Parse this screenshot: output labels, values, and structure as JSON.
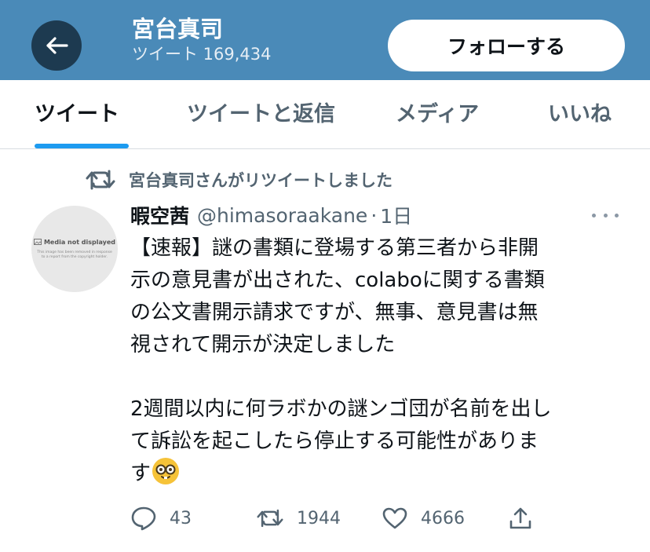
{
  "header": {
    "name": "宮台真司",
    "subtitle": "ツイート 169,434",
    "follow_label": "フォローする",
    "bg_color": "#4a8ab8"
  },
  "tabs": [
    {
      "label": "ツイート",
      "active": true
    },
    {
      "label": "ツイートと返信",
      "active": false
    },
    {
      "label": "メディア",
      "active": false
    },
    {
      "label": "いいね",
      "active": false
    }
  ],
  "retweet": {
    "text": "宮台真司さんがリツイートしました",
    "icon": "retweet-icon"
  },
  "avatar": {
    "title": "Media not displayed",
    "body": "This image has been removed in response to a report from the copyright holder."
  },
  "tweet": {
    "author_name": "暇空茜",
    "handle": "@himasoraakane",
    "dot": "·",
    "time": "1日",
    "lines": [
      "【速報】謎の書類に登場する第三者から非開",
      "示の意見書が出された、colaboに関する書類",
      "の公文書開示請求ですが、無事、意見書は無",
      "視されて開示が決定しました",
      "",
      "2週間以内に何ラボかの謎ンゴ団が名前を出し",
      "て訴訟を起こしたら停止する可能性がありま",
      "す"
    ],
    "emoji": "nerd-face"
  },
  "actions": {
    "reply_count": "43",
    "retweet_count": "1944",
    "like_count": "4666"
  },
  "colors": {
    "accent": "#1d9bf0",
    "muted_text": "#536471"
  }
}
